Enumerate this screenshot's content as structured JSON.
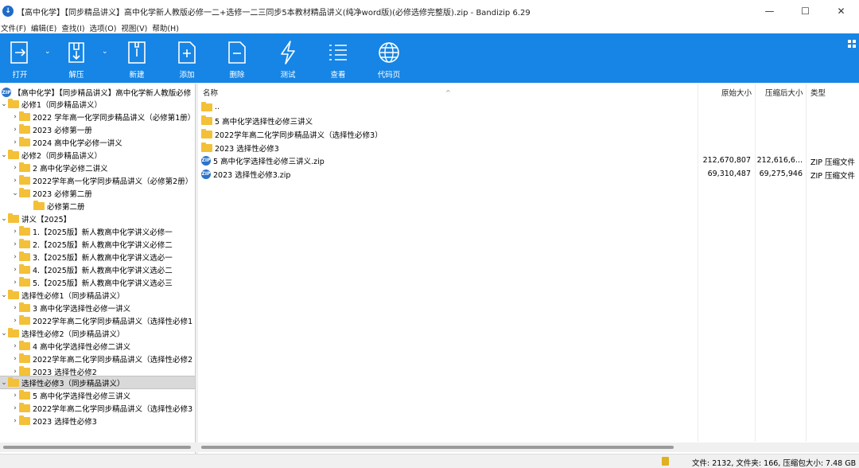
{
  "window": {
    "title": "【高中化学】【同步精品讲义】高中化学新人教版必修一二+选修一二三同步5本教材精品讲义(纯净word版)(必修选修完整版).zip - Bandizip 6.29",
    "minimize": "—",
    "maximize": "☐",
    "close": "✕"
  },
  "menu": [
    "文件(F)",
    "编辑(E)",
    "查找(I)",
    "选项(O)",
    "视图(V)",
    "帮助(H)"
  ],
  "toolbar": {
    "open": "打开",
    "extract": "解压",
    "new": "新建",
    "add": "添加",
    "delete": "删除",
    "test": "测试",
    "view": "查看",
    "codepage": "代码页"
  },
  "tree": {
    "root": "【高中化学】【同步精品讲义】高中化学新人教版必修",
    "groups": [
      {
        "label": "必修1（同步精品讲义）",
        "children": [
          "2022 学年高一化学同步精品讲义（必修第1册）",
          "2023 必修第一册",
          "2024 高中化学必修一讲义"
        ]
      },
      {
        "label": "必修2（同步精品讲义）",
        "children": [
          "2 高中化学必修二讲义",
          "2022学年高一化学同步精品讲义（必修第2册）",
          "2023 必修第二册"
        ],
        "grandchild": "必修第二册"
      },
      {
        "label": "讲义【2025】",
        "children": [
          "1.【2025版】新人教高中化学讲义必修一",
          "2.【2025版】新人教高中化学讲义必修二",
          "3.【2025版】新人教高中化学讲义选必一",
          "4.【2025版】新人教高中化学讲义选必二",
          "5.【2025版】新人教高中化学讲义选必三"
        ]
      },
      {
        "label": "选择性必修1（同步精品讲义）",
        "children": [
          "3 高中化学选择性必修一讲义",
          "2022学年高二化学同步精品讲义（选择性必修1"
        ]
      },
      {
        "label": "选择性必修2（同步精品讲义）",
        "children": [
          "4 高中化学选择性必修二讲义",
          "2022学年高二化学同步精品讲义（选择性必修2",
          "2023 选择性必修2"
        ]
      },
      {
        "label": "选择性必修3（同步精品讲义）",
        "children": [
          "5 高中化学选择性必修三讲义",
          "2022学年高二化学同步精品讲义（选择性必修3",
          "2023 选择性必修3"
        ]
      }
    ]
  },
  "columns": {
    "name": "名称",
    "original": "原始大小",
    "compressed": "压缩后大小",
    "type": "类型"
  },
  "files": [
    {
      "name": "..",
      "original": "",
      "compressed": "",
      "type": "",
      "icon": "folder"
    },
    {
      "name": "5 高中化学选择性必修三讲义",
      "original": "",
      "compressed": "",
      "type": "",
      "icon": "folder"
    },
    {
      "name": "2022学年高二化学同步精品讲义（选择性必修3）",
      "original": "",
      "compressed": "",
      "type": "",
      "icon": "folder"
    },
    {
      "name": "2023 选择性必修3",
      "original": "",
      "compressed": "",
      "type": "",
      "icon": "folder"
    },
    {
      "name": "5 高中化学选择性必修三讲义.zip",
      "original": "212,670,807",
      "compressed": "212,616,6...",
      "type": "ZIP 压缩文件",
      "icon": "zip"
    },
    {
      "name": "2023 选择性必修3.zip",
      "original": "69,310,487",
      "compressed": "69,275,946",
      "type": "ZIP 压缩文件",
      "icon": "zip"
    }
  ],
  "status": "文件: 2132, 文件夹: 166, 压缩包大小: 7.48 GB",
  "colors": {
    "toolbar": "#1685e5",
    "folder": "#f3c038",
    "selection": "#d9d9d9"
  }
}
